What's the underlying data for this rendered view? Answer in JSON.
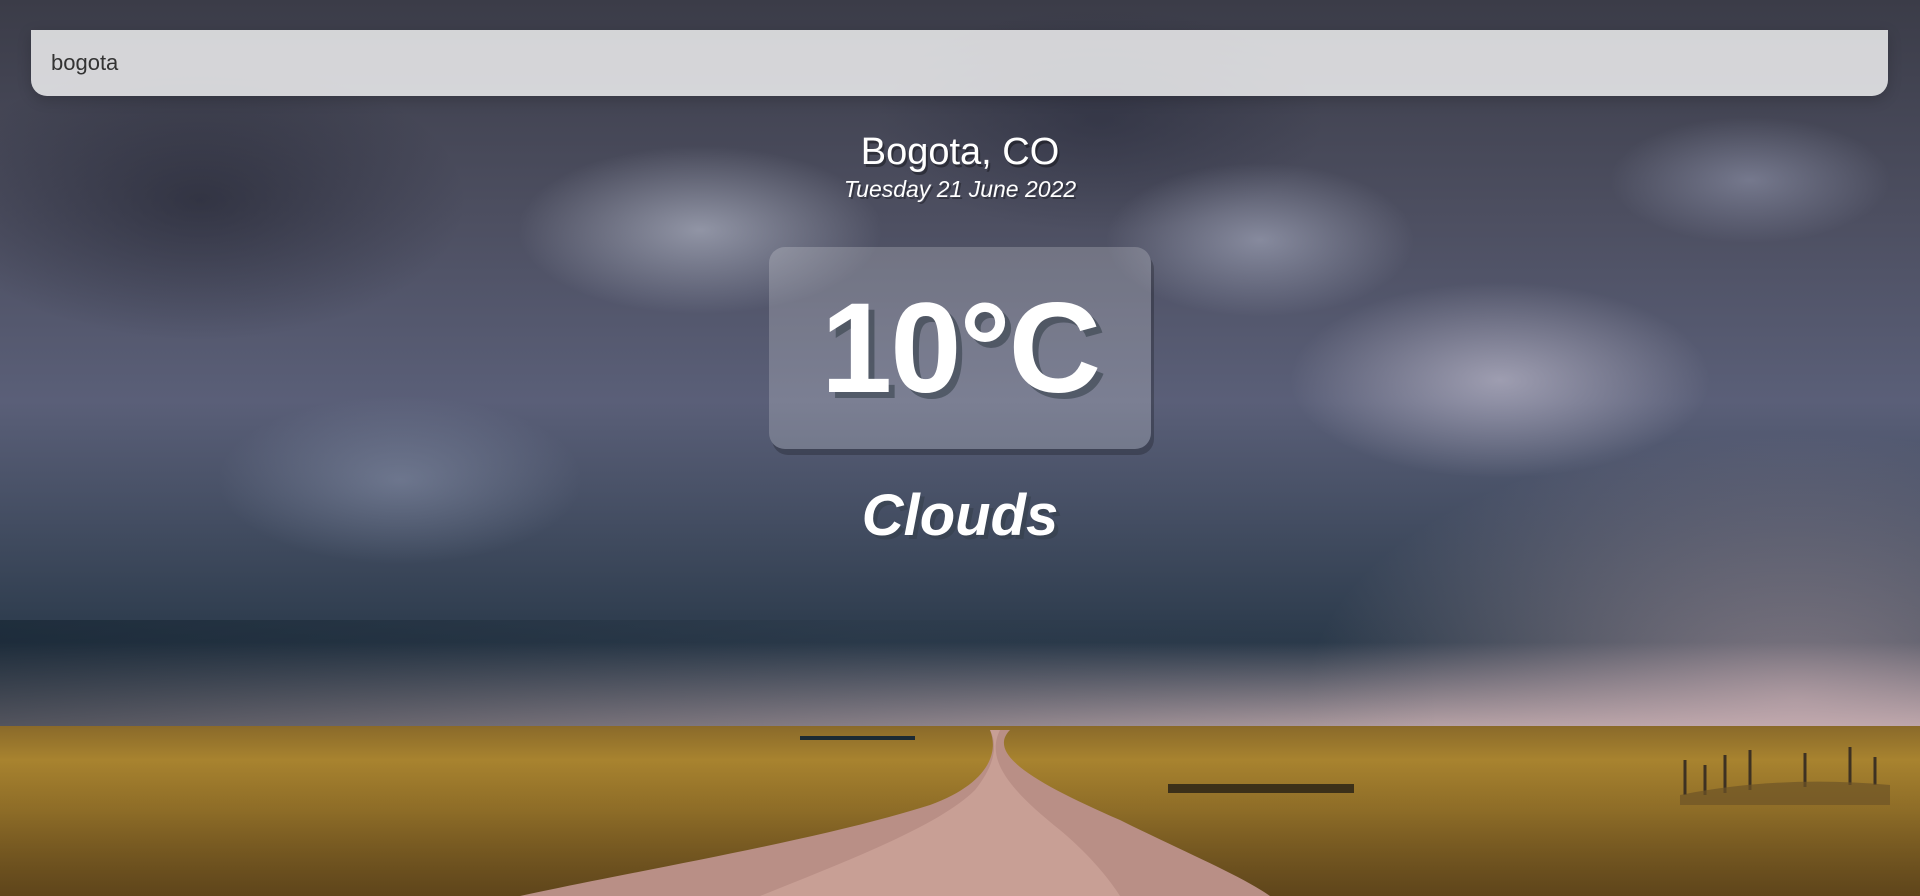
{
  "search": {
    "value": "bogota"
  },
  "location": {
    "city": "Bogota, CO",
    "date": "Tuesday 21 June 2022"
  },
  "weather": {
    "temperature": "10°C",
    "condition": "Clouds"
  },
  "colors": {
    "text": "#ffffff",
    "search_background": "#ececef",
    "search_text": "#333333"
  }
}
